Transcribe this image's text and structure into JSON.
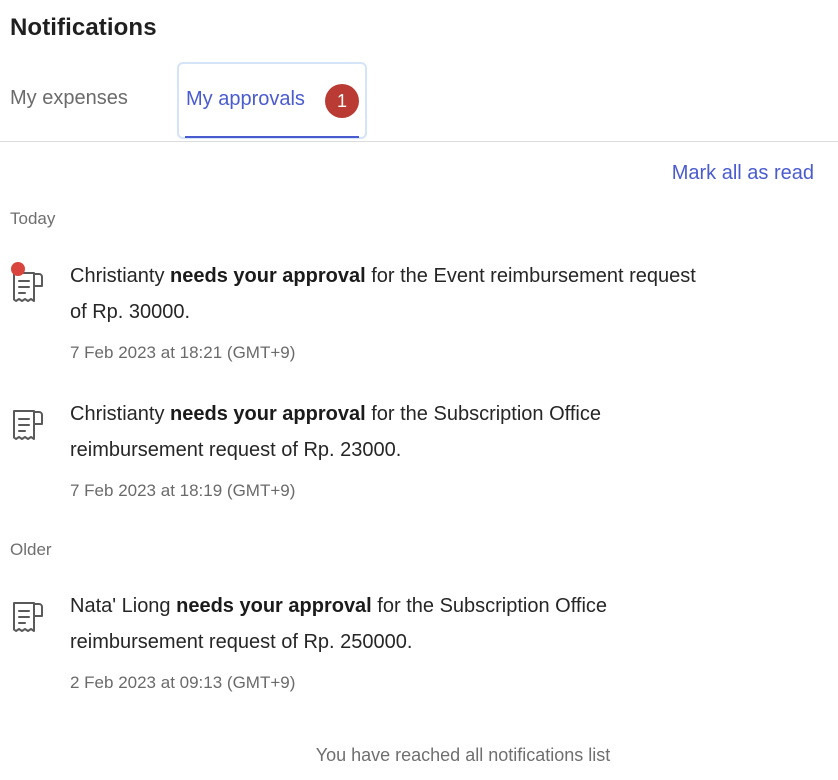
{
  "header": {
    "title": "Notifications"
  },
  "tabs": [
    {
      "label": "My expenses",
      "active": false
    },
    {
      "label": "My approvals",
      "active": true,
      "badge": "1"
    }
  ],
  "actions": {
    "mark_all_label": "Mark all as read"
  },
  "sections": [
    {
      "label": "Today",
      "items": [
        {
          "icon": "receipt-icon",
          "unread": true,
          "actor": "Christianty",
          "action": "needs your approval",
          "rest": " for the Event reimbursement request of Rp. 30000.",
          "time": "7 Feb 2023 at 18:21 (GMT+9)"
        },
        {
          "icon": "receipt-icon",
          "unread": false,
          "actor": "Christianty",
          "action": "needs your approval",
          "rest": " for the Subscription Office reimbursement request of Rp. 23000.",
          "time": "7 Feb 2023 at 18:19 (GMT+9)"
        }
      ]
    },
    {
      "label": "Older",
      "items": [
        {
          "icon": "receipt-icon",
          "unread": false,
          "actor": "Nata' Liong",
          "action": "needs your approval",
          "rest": " for the Subscription Office reimbursement request of Rp. 250000.",
          "time": "2 Feb 2023 at 09:13 (GMT+9)"
        }
      ]
    }
  ],
  "footer": {
    "message": "You have reached all notifications list"
  },
  "colors": {
    "accent": "#4a5bd0",
    "badge": "#b93b33",
    "unread_dot": "#d9453c"
  }
}
